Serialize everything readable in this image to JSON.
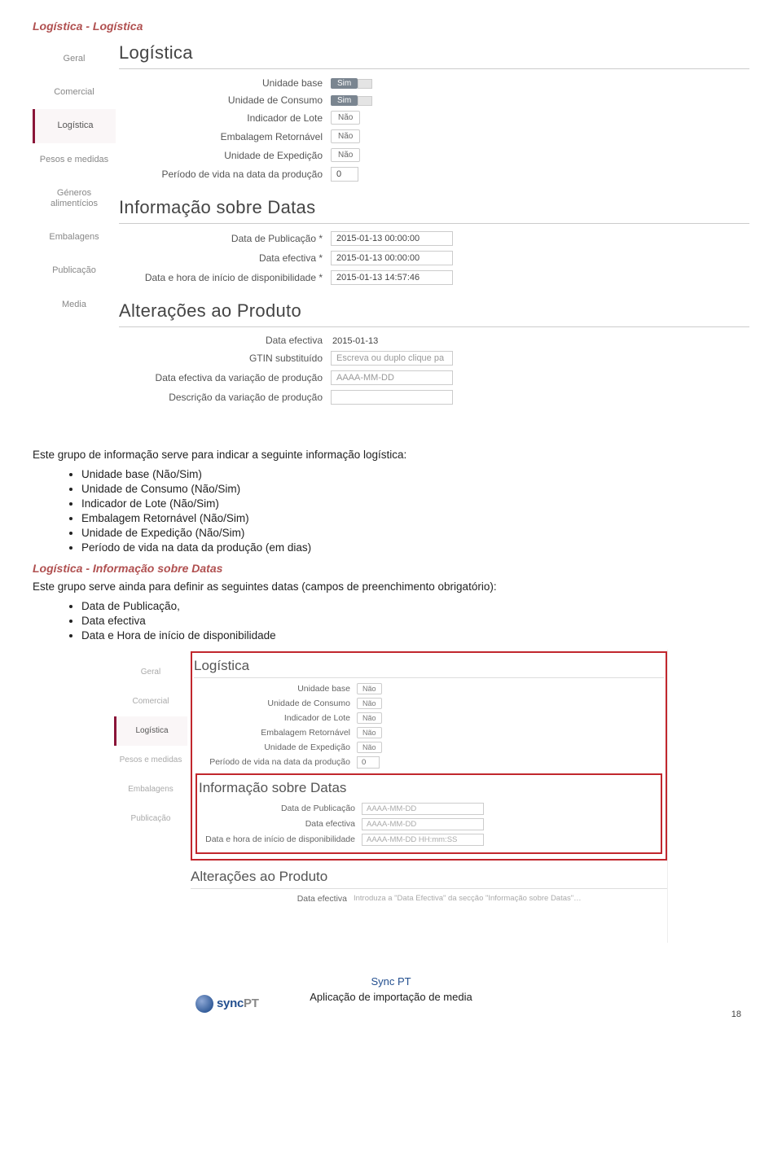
{
  "heading1": "Logística - Logística",
  "sidebar": {
    "items": [
      "Geral",
      "Comercial",
      "Logística",
      "Pesos e medidas",
      "Géneros alimentícios",
      "Embalagens",
      "Publicação",
      "Media"
    ],
    "activeIndex": 2
  },
  "panel": {
    "title": "Logística",
    "rows": {
      "unidade_base": {
        "label": "Unidade base",
        "val": "Sim"
      },
      "unidade_consumo": {
        "label": "Unidade de Consumo",
        "val": "Sim"
      },
      "indicador_lote": {
        "label": "Indicador de Lote",
        "val": "Não"
      },
      "embalagem_retornavel": {
        "label": "Embalagem Retornável",
        "val": "Não"
      },
      "unidade_expedicao": {
        "label": "Unidade de Expedição",
        "val": "Não"
      },
      "periodo_vida": {
        "label": "Período de vida na data da produção",
        "val": "0"
      }
    },
    "sec2_title": "Informação sobre Datas",
    "sec2": {
      "data_publicacao": {
        "label": "Data de Publicação *",
        "val": "2015-01-13 00:00:00"
      },
      "data_efectiva": {
        "label": "Data efectiva *",
        "val": "2015-01-13 00:00:00"
      },
      "data_disponibilidade": {
        "label": "Data e hora de início de disponibilidade *",
        "val": "2015-01-13 14:57:46"
      }
    },
    "sec3_title": "Alterações ao Produto",
    "sec3": {
      "data_efectiva": {
        "label": "Data efectiva",
        "val": "2015-01-13"
      },
      "gtin_sub": {
        "label": "GTIN substituído",
        "ph": "Escreva ou duplo clique pa"
      },
      "data_var": {
        "label": "Data efectiva da variação de produção",
        "ph": "AAAA-MM-DD"
      },
      "desc_var": {
        "label": "Descrição da variação de produção"
      }
    }
  },
  "body": {
    "para1": "Este grupo de informação serve para indicar a seguinte informação logística:",
    "list1": [
      "Unidade base (Não/Sim)",
      "Unidade de Consumo (Não/Sim)",
      "Indicador de Lote (Não/Sim)",
      "Embalagem Retornável (Não/Sim)",
      "Unidade de Expedição (Não/Sim)",
      "Período de vida na data da produção (em dias)"
    ],
    "heading2": "Logística - Informação sobre Datas",
    "para2": "Este grupo serve ainda para definir as seguintes datas (campos de preenchimento obrigatório):",
    "list2": [
      "Data de Publicação,",
      "Data efectiva",
      "Data e Hora de início de disponibilidade"
    ]
  },
  "panel2": {
    "sidebar": [
      "Geral",
      "Comercial",
      "Logística",
      "Pesos e medidas",
      "Embalagens",
      "Publicação"
    ],
    "activeIndex": 2,
    "title": "Logística",
    "rows": {
      "unidade_base": {
        "label": "Unidade base",
        "val": "Não"
      },
      "unidade_consumo": {
        "label": "Unidade de Consumo",
        "val": "Não"
      },
      "indicador_lote": {
        "label": "Indicador de Lote",
        "val": "Não"
      },
      "embalagem_retornavel": {
        "label": "Embalagem Retornável",
        "val": "Não"
      },
      "unidade_expedicao": {
        "label": "Unidade de Expedição",
        "val": "Não"
      },
      "periodo_vida": {
        "label": "Período de vida na data da produção",
        "val": "0"
      }
    },
    "sec2_title": "Informação sobre Datas",
    "sec2": {
      "data_publicacao": {
        "label": "Data de Publicação",
        "ph": "AAAA-MM-DD"
      },
      "data_efectiva": {
        "label": "Data efectiva",
        "ph": "AAAA-MM-DD"
      },
      "data_disponibilidade": {
        "label": "Data e hora de início de disponibilidade",
        "ph": "AAAA-MM-DD HH:mm:SS"
      }
    },
    "sec3_title": "Alterações ao Produto",
    "sec3": {
      "data_efectiva": {
        "label": "Data efectiva",
        "ph": "Introduza a \"Data Efectiva\" da secção \"Informação sobre Datas\"…"
      }
    }
  },
  "footer": {
    "line1": "Sync PT",
    "line2": "Aplicação de importação de media",
    "logo1": "sync",
    "logo2": "PT",
    "page": "18"
  }
}
